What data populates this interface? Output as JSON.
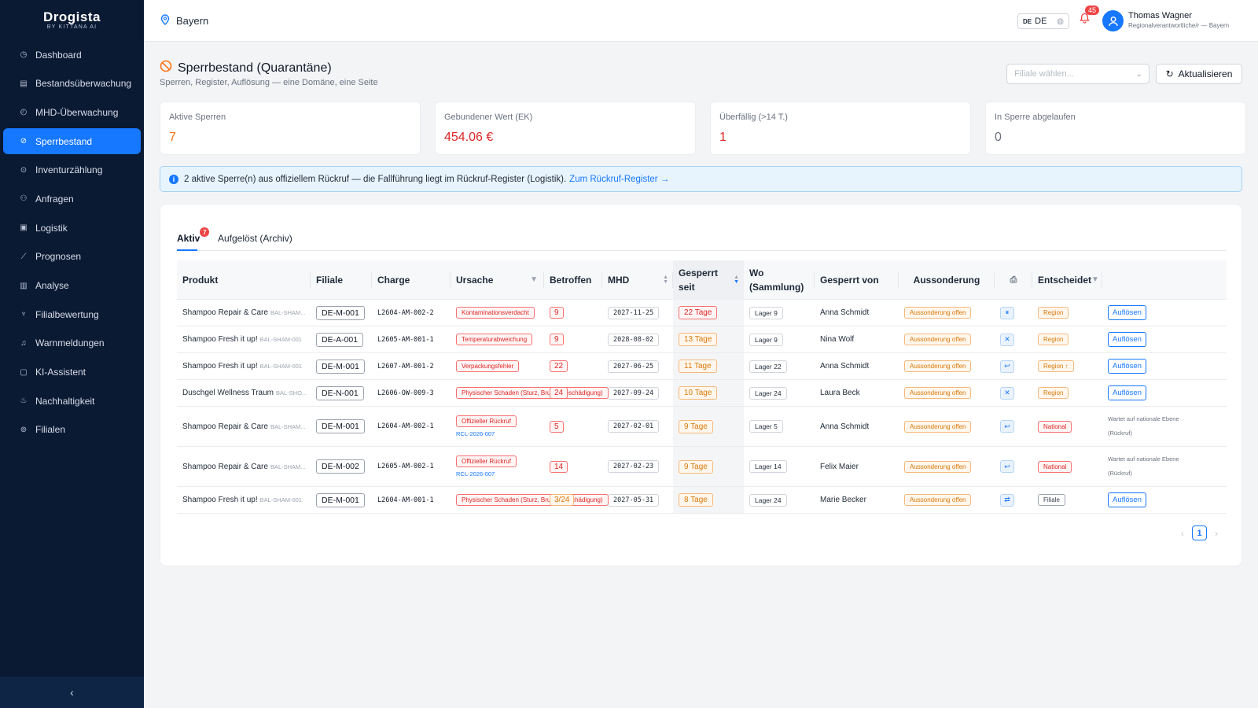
{
  "app": {
    "name": "Drogista",
    "tagline": "BY KITTANA AI"
  },
  "sidebar": {
    "items": [
      {
        "label": "Dashboard",
        "icon": "dashboard-icon"
      },
      {
        "label": "Bestandsüberwachung",
        "icon": "inventory-icon"
      },
      {
        "label": "MHD-Überwachung",
        "icon": "clock-icon"
      },
      {
        "label": "Sperrbestand",
        "icon": "ban-icon",
        "active": true
      },
      {
        "label": "Inventurzählung",
        "icon": "check-circle-icon"
      },
      {
        "label": "Anfragen",
        "icon": "requests-icon"
      },
      {
        "label": "Logistik",
        "icon": "truck-icon"
      },
      {
        "label": "Prognosen",
        "icon": "trend-icon"
      },
      {
        "label": "Analyse",
        "icon": "bar-chart-icon"
      },
      {
        "label": "Filialbewertung",
        "icon": "trophy-icon"
      },
      {
        "label": "Warnmeldungen",
        "icon": "bell-icon"
      },
      {
        "label": "KI-Assistent",
        "icon": "ai-icon"
      },
      {
        "label": "Nachhaltigkeit",
        "icon": "leaf-icon"
      },
      {
        "label": "Filialen",
        "icon": "location-icon"
      }
    ],
    "collapse_glyph": "‹"
  },
  "topbar": {
    "region": "Bayern",
    "lang_flag": "DE",
    "lang": "DE",
    "notifications": "45",
    "user_name": "Thomas Wagner",
    "user_role": "Regionalverantwortliche/r — Bayern"
  },
  "page": {
    "title": "Sperrbestand (Quarantäne)",
    "subtitle": "Sperren, Register, Auflösung — eine Domäne, eine Seite",
    "select_placeholder": "Filiale wählen...",
    "refresh_label": "Aktualisieren"
  },
  "stats": [
    {
      "label": "Aktive Sperren",
      "value": "7",
      "color": "#f97316"
    },
    {
      "label": "Gebundener Wert (EK)",
      "value": "454.06 €",
      "color": "#dc2626"
    },
    {
      "label": "Überfällig (>14 T.)",
      "value": "1",
      "color": "#dc2626"
    },
    {
      "label": "In Sperre abgelaufen",
      "value": "0",
      "color": "#6b7280"
    }
  ],
  "banner": {
    "text": "2 aktive Sperre(n) aus offiziellem Rückruf — die Fallführung liegt im Rückruf-Register (Logistik).",
    "link": "Zum Rückruf-Register →"
  },
  "tabs": [
    {
      "label": "Aktiv",
      "badge": "7"
    },
    {
      "label": "Aufgelöst (Archiv)"
    }
  ],
  "columns": {
    "produkt": "Produkt",
    "filiale": "Filiale",
    "charge": "Charge",
    "ursache": "Ursache",
    "betroffen": "Betroffen",
    "mhd": "MHD",
    "gesperrt_seit": "Gesperrt seit",
    "wo": "Wo (Sammlung)",
    "gesperrt_von": "Gesperrt von",
    "aussonderung": "Aussonderung",
    "entscheidet": "Entscheidet"
  },
  "rows": [
    {
      "product": "Shampoo Repair & Care",
      "sku": "BAL-SHAM...",
      "filiale": "DE-M-001",
      "charge": "L2604-AM-002-2",
      "cause": "Kontaminationsverdacht",
      "rcl": "",
      "affected": "9",
      "mhd": "2027-11-25",
      "days": "22 Tage",
      "days_level": "red",
      "lager": "Lager 9",
      "by": "Anna Schmidt",
      "auss": "Aussonderung offen",
      "action_glyph": "⏸",
      "decides": "Region",
      "dec_level": "orange",
      "resolve": "Auflösen",
      "wait": ""
    },
    {
      "product": "Shampoo Fresh it up!",
      "sku": "BAL-SHAM-001",
      "filiale": "DE-A-001",
      "charge": "L2605-AM-001-1",
      "cause": "Temperaturabweichung",
      "rcl": "",
      "affected": "9",
      "mhd": "2028-08-02",
      "days": "13 Tage",
      "days_level": "orange",
      "lager": "Lager 9",
      "by": "Nina Wolf",
      "auss": "Aussonderung offen",
      "action_glyph": "✕",
      "decides": "Region",
      "dec_level": "orange",
      "resolve": "Auflösen",
      "wait": ""
    },
    {
      "product": "Shampoo Fresh it up!",
      "sku": "BAL-SHAM-001",
      "filiale": "DE-M-001",
      "charge": "L2607-AM-001-2",
      "cause": "Verpackungsfehler",
      "rcl": "",
      "affected": "22",
      "mhd": "2027-06-25",
      "days": "11 Tage",
      "days_level": "orange",
      "lager": "Lager 22",
      "by": "Anna Schmidt",
      "auss": "Aussonderung offen",
      "action_glyph": "↩",
      "decides": "Region ↑",
      "dec_level": "orange",
      "resolve": "Auflösen",
      "wait": ""
    },
    {
      "product": "Duschgel Wellness Traum",
      "sku": "BAL-SHO...",
      "filiale": "DE-N-001",
      "charge": "L2606-OW-009-3",
      "cause": "Physischer Schaden (Sturz, Bruch, Beschädigung)",
      "rcl": "",
      "affected": "24",
      "mhd": "2027-09-24",
      "days": "10 Tage",
      "days_level": "orange",
      "lager": "Lager 24",
      "by": "Laura Beck",
      "auss": "Aussonderung offen",
      "action_glyph": "✕",
      "decides": "Region",
      "dec_level": "orange",
      "resolve": "Auflösen",
      "wait": ""
    },
    {
      "product": "Shampoo Repair & Care",
      "sku": "BAL-SHAM...",
      "filiale": "DE-M-001",
      "charge": "L2604-AM-002-1",
      "cause": "Offizieller Rückruf",
      "rcl": "RCL-2026-007",
      "affected": "5",
      "mhd": "2027-02-01",
      "days": "9 Tage",
      "days_level": "orange",
      "lager": "Lager 5",
      "by": "Anna Schmidt",
      "auss": "Aussonderung offen",
      "action_glyph": "↩",
      "decides": "National",
      "dec_level": "red",
      "resolve": "",
      "wait": "Wartet auf nationale Ebene (Rückruf)"
    },
    {
      "product": "Shampoo Repair & Care",
      "sku": "BAL-SHAM...",
      "filiale": "DE-M-002",
      "charge": "L2605-AM-002-1",
      "cause": "Offizieller Rückruf",
      "rcl": "RCL-2026-007",
      "affected": "14",
      "mhd": "2027-02-23",
      "days": "9 Tage",
      "days_level": "orange",
      "lager": "Lager 14",
      "by": "Felix Maier",
      "auss": "Aussonderung offen",
      "action_glyph": "↩",
      "decides": "National",
      "dec_level": "red",
      "resolve": "",
      "wait": "Wartet auf nationale Ebene (Rückruf)"
    },
    {
      "product": "Shampoo Fresh it up!",
      "sku": "BAL-SHAM-001",
      "filiale": "DE-M-001",
      "charge": "L2604-AM-001-1",
      "cause": "Physischer Schaden (Sturz, Bruch, Beschädigung)",
      "rcl": "",
      "affected": "3/24",
      "affected_level": "orange",
      "mhd": "2027-05-31",
      "days": "8 Tage",
      "days_level": "orange",
      "lager": "Lager 24",
      "by": "Marie Becker",
      "auss": "Aussonderung offen",
      "action_glyph": "⇄",
      "decides": "Filiale",
      "dec_level": "gray",
      "resolve": "Auflösen",
      "wait": ""
    }
  ],
  "pagination": {
    "prev": "‹",
    "current": "1",
    "next": "›"
  }
}
